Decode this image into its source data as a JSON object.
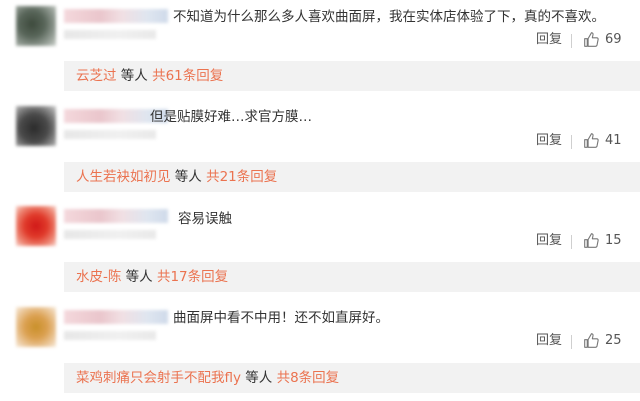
{
  "comments": [
    {
      "text": "不知道为什么那么多人喜欢曲面屏，我在实体店体验了下，真的不喜欢。",
      "reply_label": "回复",
      "likes": "69",
      "sub_user": "云芝过",
      "sub_mid": " 等人 ",
      "sub_total": "共61条回复"
    },
    {
      "text": "但是贴膜好难…求官方膜…",
      "reply_label": "回复",
      "likes": "41",
      "sub_user": "人生若袂如初见",
      "sub_mid": " 等人 ",
      "sub_total": "共21条回复"
    },
    {
      "text": "容易误触",
      "reply_label": "回复",
      "likes": "15",
      "sub_user": "水皮-陈",
      "sub_mid": " 等人 ",
      "sub_total": "共17条回复"
    },
    {
      "text": "曲面屏中看不中用！还不如直屏好。",
      "reply_label": "回复",
      "likes": "25",
      "sub_user": "菜鸡刺痛只会射手不配我fly",
      "sub_mid": " 等人 ",
      "sub_total": "共8条回复"
    }
  ],
  "colors": {
    "accent": "#eb7350",
    "subbox_bg": "#f2f2f2"
  },
  "icons": {
    "like": "thumbs-up-icon"
  }
}
